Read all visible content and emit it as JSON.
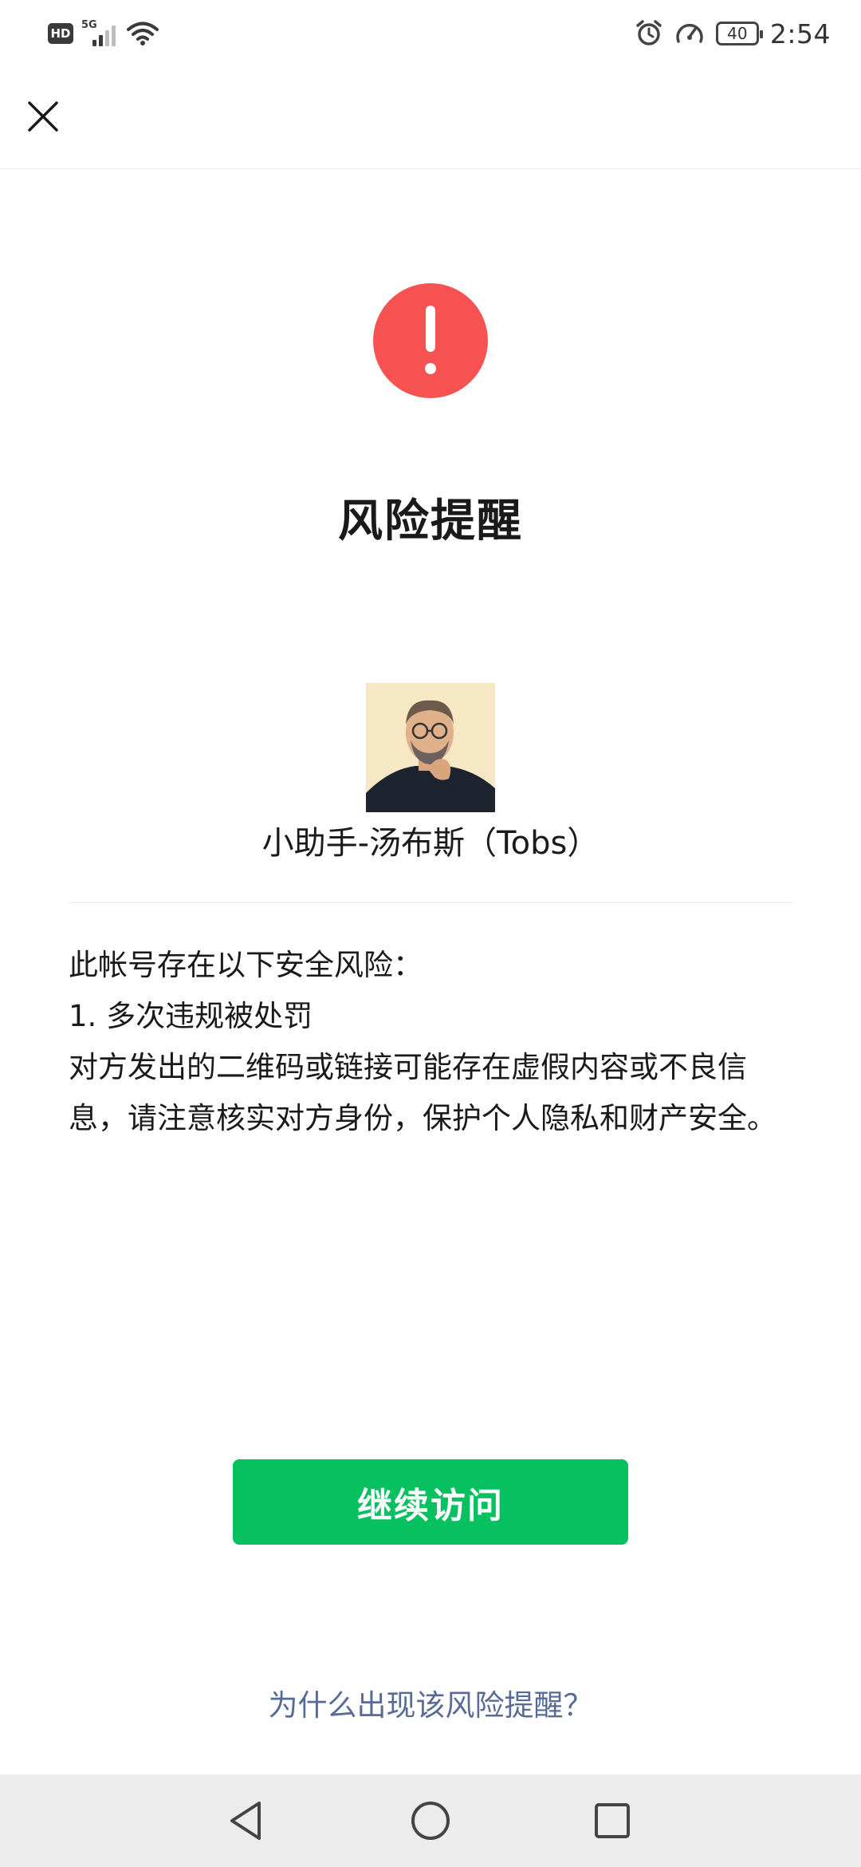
{
  "status_bar": {
    "network_badge": "HD",
    "network_type": "5G",
    "battery_level": "40",
    "time": "2:54",
    "icons": [
      "hd-icon",
      "signal-icon",
      "wifi-icon",
      "alarm-icon",
      "speed-icon",
      "battery-icon"
    ]
  },
  "top_nav": {
    "close_icon": "close-icon"
  },
  "warning": {
    "icon": "warning-icon",
    "icon_color": "#f75252",
    "title": "风险提醒"
  },
  "account": {
    "avatar": "avatar",
    "name": "小助手-汤布斯（Tobs）"
  },
  "risk_info": {
    "heading": "此帐号存在以下安全风险：",
    "item_1": "1. 多次违规被处罚",
    "description": "对方发出的二维码或链接可能存在虚假内容或不良信息，请注意核实对方身份，保护个人隐私和财产安全。"
  },
  "actions": {
    "continue_label": "继续访问",
    "continue_color": "#07c160",
    "why_link": "为什么出现该风险提醒？",
    "link_color": "#576b95"
  },
  "nav_bar": {
    "icons": [
      "back-icon",
      "home-icon",
      "recents-icon"
    ]
  }
}
